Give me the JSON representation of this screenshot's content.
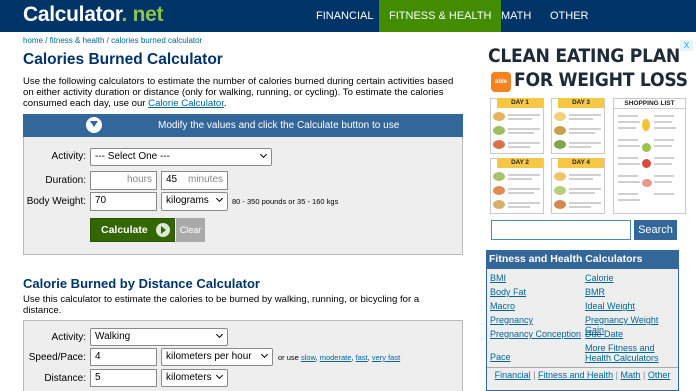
{
  "header": {
    "logo_main": "Calculator",
    "logo_dot": ".",
    "logo_net": "net",
    "nav": [
      "FINANCIAL",
      "FITNESS & HEALTH",
      "MATH",
      "OTHER"
    ],
    "active_nav": "FITNESS & HEALTH"
  },
  "breadcrumb": [
    "home",
    "fitness & health",
    "calories burned calculator"
  ],
  "page_title": "Calories Burned Calculator",
  "intro": {
    "text": "Use the following calculators to estimate the number of calories burned during certain activities based on either activity duration or distance (only for walking, running, or cycling). To estimate the calories consumed each day, use our",
    "link": "Calorie Calculator",
    "end": "."
  },
  "calc1": {
    "banner": "Modify the values and click the Calculate button to use",
    "activity_label": "Activity:",
    "activity_value": "--- Select One ---",
    "duration_label": "Duration:",
    "hours_value": "",
    "hours_placeholder": "hours",
    "minutes_value": "45",
    "minutes_unit": "minutes",
    "weight_label": "Body Weight:",
    "weight_value": "70",
    "weight_unit": "kilograms",
    "weight_hint": "80 - 350 pounds or 35 - 160 kgs",
    "calculate_label": "Calculate",
    "clear_label": "Clear"
  },
  "calc2": {
    "title": "Calorie Burned by Distance Calculator",
    "intro": "Use this calculator to estimate the calories to be burned by walking, running, or bicycling for a distance.",
    "activity_label": "Activity:",
    "activity_value": "Walking",
    "speed_label": "Speed/Pace:",
    "speed_value": "4",
    "speed_unit": "kilometers per hour",
    "speed_hint_prefix": "or use",
    "speed_hint_links": [
      "slow",
      "moderate",
      "fast",
      "very fast"
    ],
    "distance_label": "Distance:",
    "distance_value": "5",
    "distance_unit": "kilometers"
  },
  "ad": {
    "line1": "CLEAN EATING PLAN",
    "line2": "FOR WEIGHT LOSS",
    "logo": "able",
    "close": "X",
    "days": [
      "DAY 1",
      "DAY 3",
      "DAY 2",
      "DAY 4"
    ],
    "shopping": "SHOPPING LIST"
  },
  "search": {
    "button": "Search"
  },
  "sidebar": {
    "title": "Fitness and Health Calculators",
    "col1": [
      "BMI",
      "Body Fat",
      "Macro",
      "Pregnancy",
      "Pregnancy Conception",
      "Pace"
    ],
    "col2": [
      "Calorie",
      "BMR",
      "Ideal Weight",
      "Pregnancy Weight Gain",
      "Due Date",
      "More Fitness and Health Calculators"
    ],
    "footer": [
      "Financial",
      "Fitness and Health",
      "Math",
      "Other"
    ]
  },
  "colors": {
    "header_bg": "#003366",
    "accent_green": "#418c00",
    "panel_blue": "#336699"
  }
}
